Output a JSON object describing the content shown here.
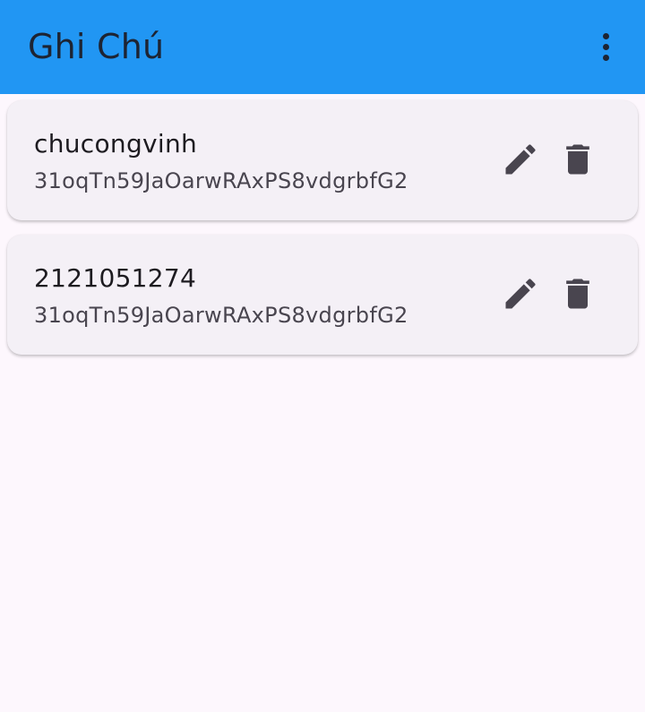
{
  "app_bar": {
    "title": "Ghi Chú",
    "background": "#2196f3",
    "menu_icon": "more-vert-icon"
  },
  "notes": [
    {
      "title": "chucongvinh",
      "content": "31oqTn59JaOarwRAxPS8vdgrbfG2",
      "edit_icon": "edit-icon",
      "delete_icon": "delete-icon"
    },
    {
      "title": "2121051274",
      "content": "31oqTn59JaOarwRAxPS8vdgrbfG2",
      "edit_icon": "edit-icon",
      "delete_icon": "delete-icon"
    }
  ]
}
